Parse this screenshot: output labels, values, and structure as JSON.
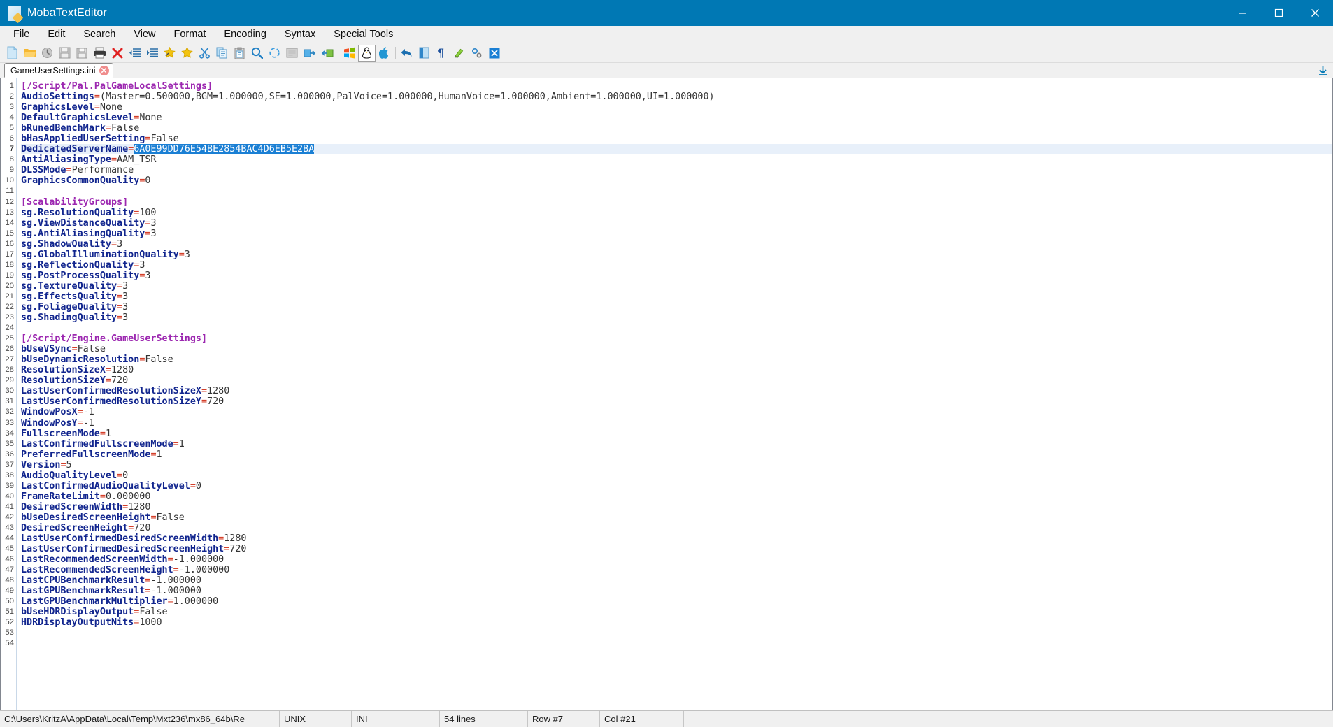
{
  "window": {
    "title": "MobaTextEditor",
    "icon": "document-pencil-icon",
    "minimize_label": "Minimize",
    "maximize_label": "Maximize",
    "close_label": "Close",
    "titlebar_color": "#0078b4"
  },
  "menu": {
    "items": [
      {
        "label": "File"
      },
      {
        "label": "Edit"
      },
      {
        "label": "Search"
      },
      {
        "label": "View"
      },
      {
        "label": "Format"
      },
      {
        "label": "Encoding"
      },
      {
        "label": "Syntax"
      },
      {
        "label": "Special Tools"
      }
    ]
  },
  "toolbar": {
    "buttons": [
      {
        "name": "new-file-icon",
        "tooltip": "New file"
      },
      {
        "name": "open-folder-icon",
        "tooltip": "Open"
      },
      {
        "name": "reload-icon",
        "tooltip": "Reload"
      },
      {
        "name": "save-icon",
        "tooltip": "Save"
      },
      {
        "name": "save-as-icon",
        "tooltip": "Save as"
      },
      {
        "name": "print-icon",
        "tooltip": "Print"
      },
      {
        "name": "close-red-x-icon",
        "tooltip": "Close"
      },
      {
        "name": "outdent-icon",
        "tooltip": "Decrease indent"
      },
      {
        "name": "indent-icon",
        "tooltip": "Increase indent"
      },
      {
        "name": "bookmark-add-icon",
        "tooltip": "Toggle bookmark"
      },
      {
        "name": "bookmark-icon",
        "tooltip": "Bookmarks"
      },
      {
        "name": "cut-scissors-icon",
        "tooltip": "Cut"
      },
      {
        "name": "copy-icon",
        "tooltip": "Copy"
      },
      {
        "name": "paste-clipboard-icon",
        "tooltip": "Paste"
      },
      {
        "name": "find-magnifier-icon",
        "tooltip": "Find"
      },
      {
        "name": "find-replace-icon",
        "tooltip": "Replace"
      },
      {
        "name": "word-wrap-icon",
        "tooltip": "Word wrap"
      },
      {
        "name": "goto-next-icon",
        "tooltip": "Go to next"
      },
      {
        "name": "goto-prev-icon",
        "tooltip": "Go to previous"
      },
      {
        "name": "windows-format-icon",
        "tooltip": "Windows (CRLF)"
      },
      {
        "name": "linux-format-icon",
        "tooltip": "Unix (LF)"
      },
      {
        "name": "mac-format-icon",
        "tooltip": "Mac (CR)"
      },
      {
        "name": "undo-icon",
        "tooltip": "Undo"
      },
      {
        "name": "redo-icon",
        "tooltip": "Redo"
      },
      {
        "name": "pilcrow-icon",
        "tooltip": "Show special characters"
      },
      {
        "name": "highlighter-icon",
        "tooltip": "Highlight"
      },
      {
        "name": "settings-gear-icon",
        "tooltip": "Settings"
      },
      {
        "name": "exit-icon",
        "tooltip": "Exit"
      }
    ]
  },
  "tabs": {
    "items": [
      {
        "label": "GameUserSettings.ini",
        "close_icon": "tab-close-icon",
        "active": true
      }
    ],
    "scroll_down_icon": "scroll-down-arrow-icon"
  },
  "editor": {
    "total_lines": 54,
    "current_line": 7,
    "selection": {
      "line": 7,
      "text": "6A0E99DD76E54BE2854BAC4D6EB5E2BA"
    },
    "lines": [
      {
        "n": 1,
        "type": "section",
        "text": "[/Script/Pal.PalGameLocalSettings]"
      },
      {
        "n": 2,
        "type": "pair",
        "key": "AudioSettings",
        "value": "(Master=0.500000,BGM=1.000000,SE=1.000000,PalVoice=1.000000,HumanVoice=1.000000,Ambient=1.000000,UI=1.000000)"
      },
      {
        "n": 3,
        "type": "pair",
        "key": "GraphicsLevel",
        "value": "None"
      },
      {
        "n": 4,
        "type": "pair",
        "key": "DefaultGraphicsLevel",
        "value": "None"
      },
      {
        "n": 5,
        "type": "pair",
        "key": "bRunedBenchMark",
        "value": "False"
      },
      {
        "n": 6,
        "type": "pair",
        "key": "bHasAppliedUserSetting",
        "value": "False"
      },
      {
        "n": 7,
        "type": "pair",
        "key": "DedicatedServerName",
        "value": "6A0E99DD76E54BE2854BAC4D6EB5E2BA",
        "selected": true,
        "current": true
      },
      {
        "n": 8,
        "type": "pair",
        "key": "AntiAliasingType",
        "value": "AAM_TSR"
      },
      {
        "n": 9,
        "type": "pair",
        "key": "DLSSMode",
        "value": "Performance"
      },
      {
        "n": 10,
        "type": "pair",
        "key": "GraphicsCommonQuality",
        "value": "0"
      },
      {
        "n": 11,
        "type": "blank",
        "text": ""
      },
      {
        "n": 12,
        "type": "section",
        "text": "[ScalabilityGroups]"
      },
      {
        "n": 13,
        "type": "pair",
        "key": "sg.ResolutionQuality",
        "value": "100"
      },
      {
        "n": 14,
        "type": "pair",
        "key": "sg.ViewDistanceQuality",
        "value": "3"
      },
      {
        "n": 15,
        "type": "pair",
        "key": "sg.AntiAliasingQuality",
        "value": "3"
      },
      {
        "n": 16,
        "type": "pair",
        "key": "sg.ShadowQuality",
        "value": "3"
      },
      {
        "n": 17,
        "type": "pair",
        "key": "sg.GlobalIlluminationQuality",
        "value": "3"
      },
      {
        "n": 18,
        "type": "pair",
        "key": "sg.ReflectionQuality",
        "value": "3"
      },
      {
        "n": 19,
        "type": "pair",
        "key": "sg.PostProcessQuality",
        "value": "3"
      },
      {
        "n": 20,
        "type": "pair",
        "key": "sg.TextureQuality",
        "value": "3"
      },
      {
        "n": 21,
        "type": "pair",
        "key": "sg.EffectsQuality",
        "value": "3"
      },
      {
        "n": 22,
        "type": "pair",
        "key": "sg.FoliageQuality",
        "value": "3"
      },
      {
        "n": 23,
        "type": "pair",
        "key": "sg.ShadingQuality",
        "value": "3"
      },
      {
        "n": 24,
        "type": "blank",
        "text": ""
      },
      {
        "n": 25,
        "type": "section",
        "text": "[/Script/Engine.GameUserSettings]"
      },
      {
        "n": 26,
        "type": "pair",
        "key": "bUseVSync",
        "value": "False"
      },
      {
        "n": 27,
        "type": "pair",
        "key": "bUseDynamicResolution",
        "value": "False"
      },
      {
        "n": 28,
        "type": "pair",
        "key": "ResolutionSizeX",
        "value": "1280"
      },
      {
        "n": 29,
        "type": "pair",
        "key": "ResolutionSizeY",
        "value": "720"
      },
      {
        "n": 30,
        "type": "pair",
        "key": "LastUserConfirmedResolutionSizeX",
        "value": "1280"
      },
      {
        "n": 31,
        "type": "pair",
        "key": "LastUserConfirmedResolutionSizeY",
        "value": "720"
      },
      {
        "n": 32,
        "type": "pair",
        "key": "WindowPosX",
        "value": "-1"
      },
      {
        "n": 33,
        "type": "pair",
        "key": "WindowPosY",
        "value": "-1"
      },
      {
        "n": 34,
        "type": "pair",
        "key": "FullscreenMode",
        "value": "1"
      },
      {
        "n": 35,
        "type": "pair",
        "key": "LastConfirmedFullscreenMode",
        "value": "1"
      },
      {
        "n": 36,
        "type": "pair",
        "key": "PreferredFullscreenMode",
        "value": "1"
      },
      {
        "n": 37,
        "type": "pair",
        "key": "Version",
        "value": "5"
      },
      {
        "n": 38,
        "type": "pair",
        "key": "AudioQualityLevel",
        "value": "0"
      },
      {
        "n": 39,
        "type": "pair",
        "key": "LastConfirmedAudioQualityLevel",
        "value": "0"
      },
      {
        "n": 40,
        "type": "pair",
        "key": "FrameRateLimit",
        "value": "0.000000"
      },
      {
        "n": 41,
        "type": "pair",
        "key": "DesiredScreenWidth",
        "value": "1280"
      },
      {
        "n": 42,
        "type": "pair",
        "key": "bUseDesiredScreenHeight",
        "value": "False"
      },
      {
        "n": 43,
        "type": "pair",
        "key": "DesiredScreenHeight",
        "value": "720"
      },
      {
        "n": 44,
        "type": "pair",
        "key": "LastUserConfirmedDesiredScreenWidth",
        "value": "1280"
      },
      {
        "n": 45,
        "type": "pair",
        "key": "LastUserConfirmedDesiredScreenHeight",
        "value": "720"
      },
      {
        "n": 46,
        "type": "pair",
        "key": "LastRecommendedScreenWidth",
        "value": "-1.000000"
      },
      {
        "n": 47,
        "type": "pair",
        "key": "LastRecommendedScreenHeight",
        "value": "-1.000000"
      },
      {
        "n": 48,
        "type": "pair",
        "key": "LastCPUBenchmarkResult",
        "value": "-1.000000"
      },
      {
        "n": 49,
        "type": "pair",
        "key": "LastGPUBenchmarkResult",
        "value": "-1.000000"
      },
      {
        "n": 50,
        "type": "pair",
        "key": "LastGPUBenchmarkMultiplier",
        "value": "1.000000"
      },
      {
        "n": 51,
        "type": "pair",
        "key": "bUseHDRDisplayOutput",
        "value": "False"
      },
      {
        "n": 52,
        "type": "pair",
        "key": "HDRDisplayOutputNits",
        "value": "1000"
      },
      {
        "n": 53,
        "type": "blank",
        "text": ""
      },
      {
        "n": 54,
        "type": "blank",
        "text": ""
      }
    ]
  },
  "statusbar": {
    "path": "C:\\Users\\KritzA\\AppData\\Local\\Temp\\Mxt236\\mx86_64b\\Re",
    "eol": "UNIX",
    "syntax": "INI",
    "lines": "54 lines",
    "row": "Row #7",
    "col": "Col #21"
  },
  "colors": {
    "accent": "#0078b4",
    "section": "#9c27b0",
    "key": "#11258e",
    "equals": "#d43f2a",
    "value": "#333333",
    "selection": "#1a7fd4",
    "current_line": "#e8f0fa"
  }
}
